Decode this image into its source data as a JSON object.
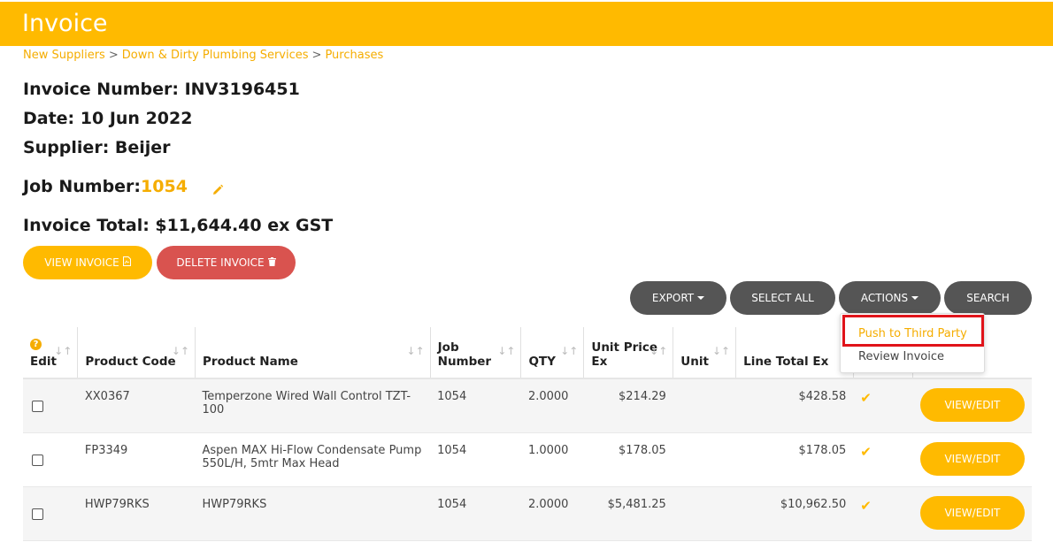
{
  "header": {
    "title": "Invoice"
  },
  "breadcrumb": [
    "New Suppliers",
    "Down & Dirty Plumbing Services",
    "Purchases"
  ],
  "invoice": {
    "number_label": "Invoice Number: INV3196451",
    "date_label": "Date: 10 Jun 2022",
    "supplier_label": "Supplier: Beijer",
    "job_label": "Job Number:",
    "job_value": "1054",
    "total_label": "Invoice Total: $11,644.40 ex GST"
  },
  "buttons": {
    "view_invoice": "VIEW INVOICE",
    "delete_invoice": "DELETE INVOICE",
    "export": "EXPORT",
    "select_all": "SELECT ALL",
    "actions": "ACTIONS",
    "search": "SEARCH"
  },
  "actions_menu": [
    "Push to Third Party",
    "Review Invoice"
  ],
  "table": {
    "columns": [
      "Edit",
      "Product Code",
      "Product Name",
      "Job Number",
      "QTY",
      "Unit Price Ex",
      "Unit",
      "Line Total Ex"
    ],
    "rows": [
      {
        "code": "XX0367",
        "name": "Temperzone Wired Wall Control TZT-100",
        "job": "1054",
        "qty": "2.0000",
        "unit_price": "$214.29",
        "unit": "",
        "total": "$428.58",
        "action": "VIEW/EDIT"
      },
      {
        "code": "FP3349",
        "name": "Aspen MAX Hi-Flow Condensate Pump 550L/H, 5mtr Max Head",
        "job": "1054",
        "qty": "1.0000",
        "unit_price": "$178.05",
        "unit": "",
        "total": "$178.05",
        "action": "VIEW/EDIT"
      },
      {
        "code": "HWP79RKS",
        "name": "HWP79RKS",
        "job": "1054",
        "qty": "2.0000",
        "unit_price": "$5,481.25",
        "unit": "",
        "total": "$10,962.50",
        "action": "VIEW/EDIT"
      }
    ]
  },
  "colors": {
    "accent": "#ffba00",
    "danger": "#d9534f",
    "dark": "#555555",
    "highlight_box": "#e0131a"
  },
  "icons": [
    "pencil-icon",
    "pdf-icon",
    "trash-icon",
    "help-icon",
    "sort-icon",
    "check-icon",
    "caret-down-icon"
  ]
}
